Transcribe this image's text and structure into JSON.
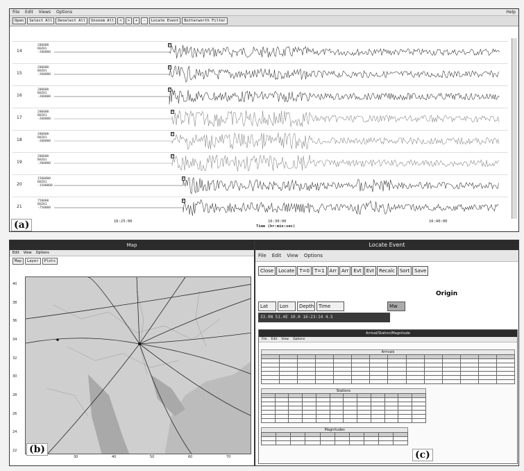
{
  "panel_a": {
    "label": "(a)",
    "menu": [
      "File",
      "Edit",
      "Views",
      "Options"
    ],
    "menu_right": "Help",
    "toolbar": [
      "Open",
      "Select All",
      "Deselect All",
      "Unzoom All",
      "<",
      ">",
      "+",
      "-",
      "Locate Event",
      "Butterworth Filter"
    ],
    "traces": [
      {
        "name": "14",
        "scale_top": "200000",
        "scale_mid": "BHZ01",
        "scale_bot": "-200000"
      },
      {
        "name": "15",
        "scale_top": "200000",
        "scale_mid": "BHZ01",
        "scale_bot": "-200000"
      },
      {
        "name": "16",
        "scale_top": "200000",
        "scale_mid": "BHZ01",
        "scale_bot": "-200000"
      },
      {
        "name": "17",
        "scale_top": "200000",
        "scale_mid": "BHZ01",
        "scale_bot": "-200000"
      },
      {
        "name": "18",
        "scale_top": "200000",
        "scale_mid": "BHZ01",
        "scale_bot": "-200000"
      },
      {
        "name": "19",
        "scale_top": "200000",
        "scale_mid": "BHZ01",
        "scale_bot": "-200000"
      },
      {
        "name": "20",
        "scale_top": "1500000",
        "scale_mid": "BHZ01",
        "scale_bot": "-1500000"
      },
      {
        "name": "21",
        "scale_top": "750000",
        "scale_mid": "BHZ01",
        "scale_bot": "-750000"
      }
    ],
    "x_ticks": [
      "16:25:00",
      "16:30:00",
      "16:40:00"
    ],
    "x_title": "Time (hr:min:sec)"
  },
  "panel_b": {
    "label": "(b)",
    "title": "Map",
    "menu": [
      "Edit",
      "View",
      "Options"
    ],
    "tabs": [
      "Map",
      "Layer",
      "Plots"
    ],
    "lat_ticks": [
      "40",
      "38",
      "36",
      "34",
      "32",
      "30",
      "28",
      "26",
      "24",
      "22"
    ],
    "lon_ticks": [
      "30",
      "40",
      "50",
      "60",
      "70"
    ]
  },
  "panel_c": {
    "label": "(c)",
    "title": "Locate Event",
    "menu": [
      "File",
      "Edit",
      "View",
      "Options"
    ],
    "buttons": [
      "Close",
      "Locate",
      "T=0",
      "T=1",
      "Arr",
      "Arr",
      "Evt",
      "Evt",
      "Recalc",
      "Sort",
      "Save"
    ],
    "origin_title": "Origin",
    "origin_fields": [
      "Lat",
      "Lon",
      "Depth",
      "Time",
      "Mw"
    ],
    "origin_values": "33.0N 51.4E 10.0 16:23:14 4.5",
    "subwindow_title": "Arrival/Station/Magnitude",
    "subwindow_menu": [
      "File",
      "Edit",
      "View",
      "Options"
    ],
    "section1": "Arrivals",
    "section2": "Stations",
    "section3": "Magnitudes"
  }
}
